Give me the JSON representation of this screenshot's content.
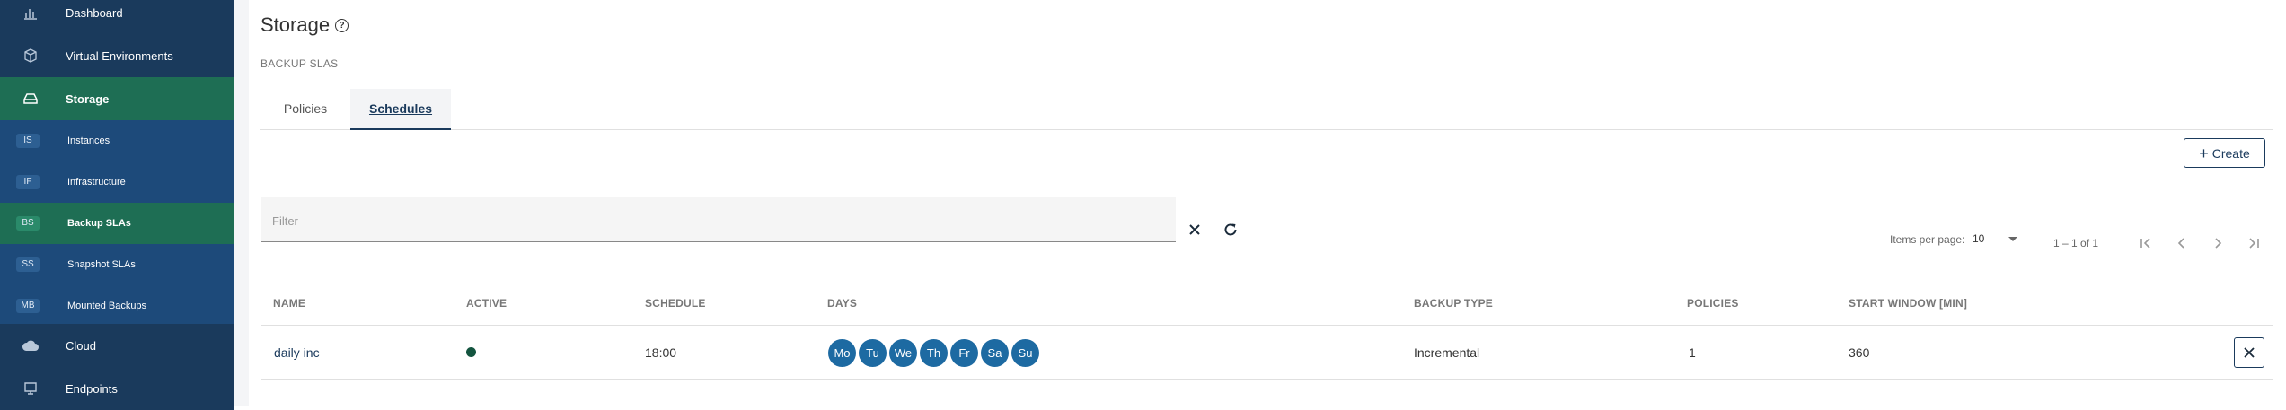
{
  "sidebar": {
    "items": [
      {
        "label": "Dashboard",
        "icon": "chart-icon"
      },
      {
        "label": "Virtual Environments",
        "icon": "box-icon"
      },
      {
        "label": "Storage",
        "icon": "drive-icon"
      },
      {
        "label": "Cloud",
        "icon": "cloud-icon"
      },
      {
        "label": "Endpoints",
        "icon": "monitor-icon"
      }
    ],
    "sub_items": [
      {
        "badge": "IS",
        "label": "Instances"
      },
      {
        "badge": "IF",
        "label": "Infrastructure"
      },
      {
        "badge": "BS",
        "label": "Backup SLAs"
      },
      {
        "badge": "SS",
        "label": "Snapshot SLAs"
      },
      {
        "badge": "MB",
        "label": "Mounted Backups"
      }
    ]
  },
  "page": {
    "title": "Storage",
    "help_icon": "?",
    "section_label": "BACKUP SLAS"
  },
  "tabs": [
    {
      "label": "Policies"
    },
    {
      "label": "Schedules"
    }
  ],
  "toolbar": {
    "create_label": "Create"
  },
  "filter": {
    "placeholder": "Filter",
    "value": ""
  },
  "pager": {
    "items_label": "Items per page:",
    "page_size": "10",
    "range": "1 – 1 of 1"
  },
  "table": {
    "columns": [
      "NAME",
      "ACTIVE",
      "SCHEDULE",
      "DAYS",
      "BACKUP TYPE",
      "POLICIES",
      "START WINDOW [MIN]"
    ],
    "rows": [
      {
        "name": "daily inc",
        "active": true,
        "schedule": "18:00",
        "days": [
          "Mo",
          "Tu",
          "We",
          "Th",
          "Fr",
          "Sa",
          "Su"
        ],
        "backup_type": "Incremental",
        "policies": "1",
        "start_window": "360"
      }
    ]
  },
  "colors": {
    "sidebar_bg": "#1a3a5c",
    "sidebar_sub_bg": "#1d4a7a",
    "active_green": "#1e6e54",
    "day_chip": "#1d6aa2",
    "active_dot": "#13543f"
  }
}
